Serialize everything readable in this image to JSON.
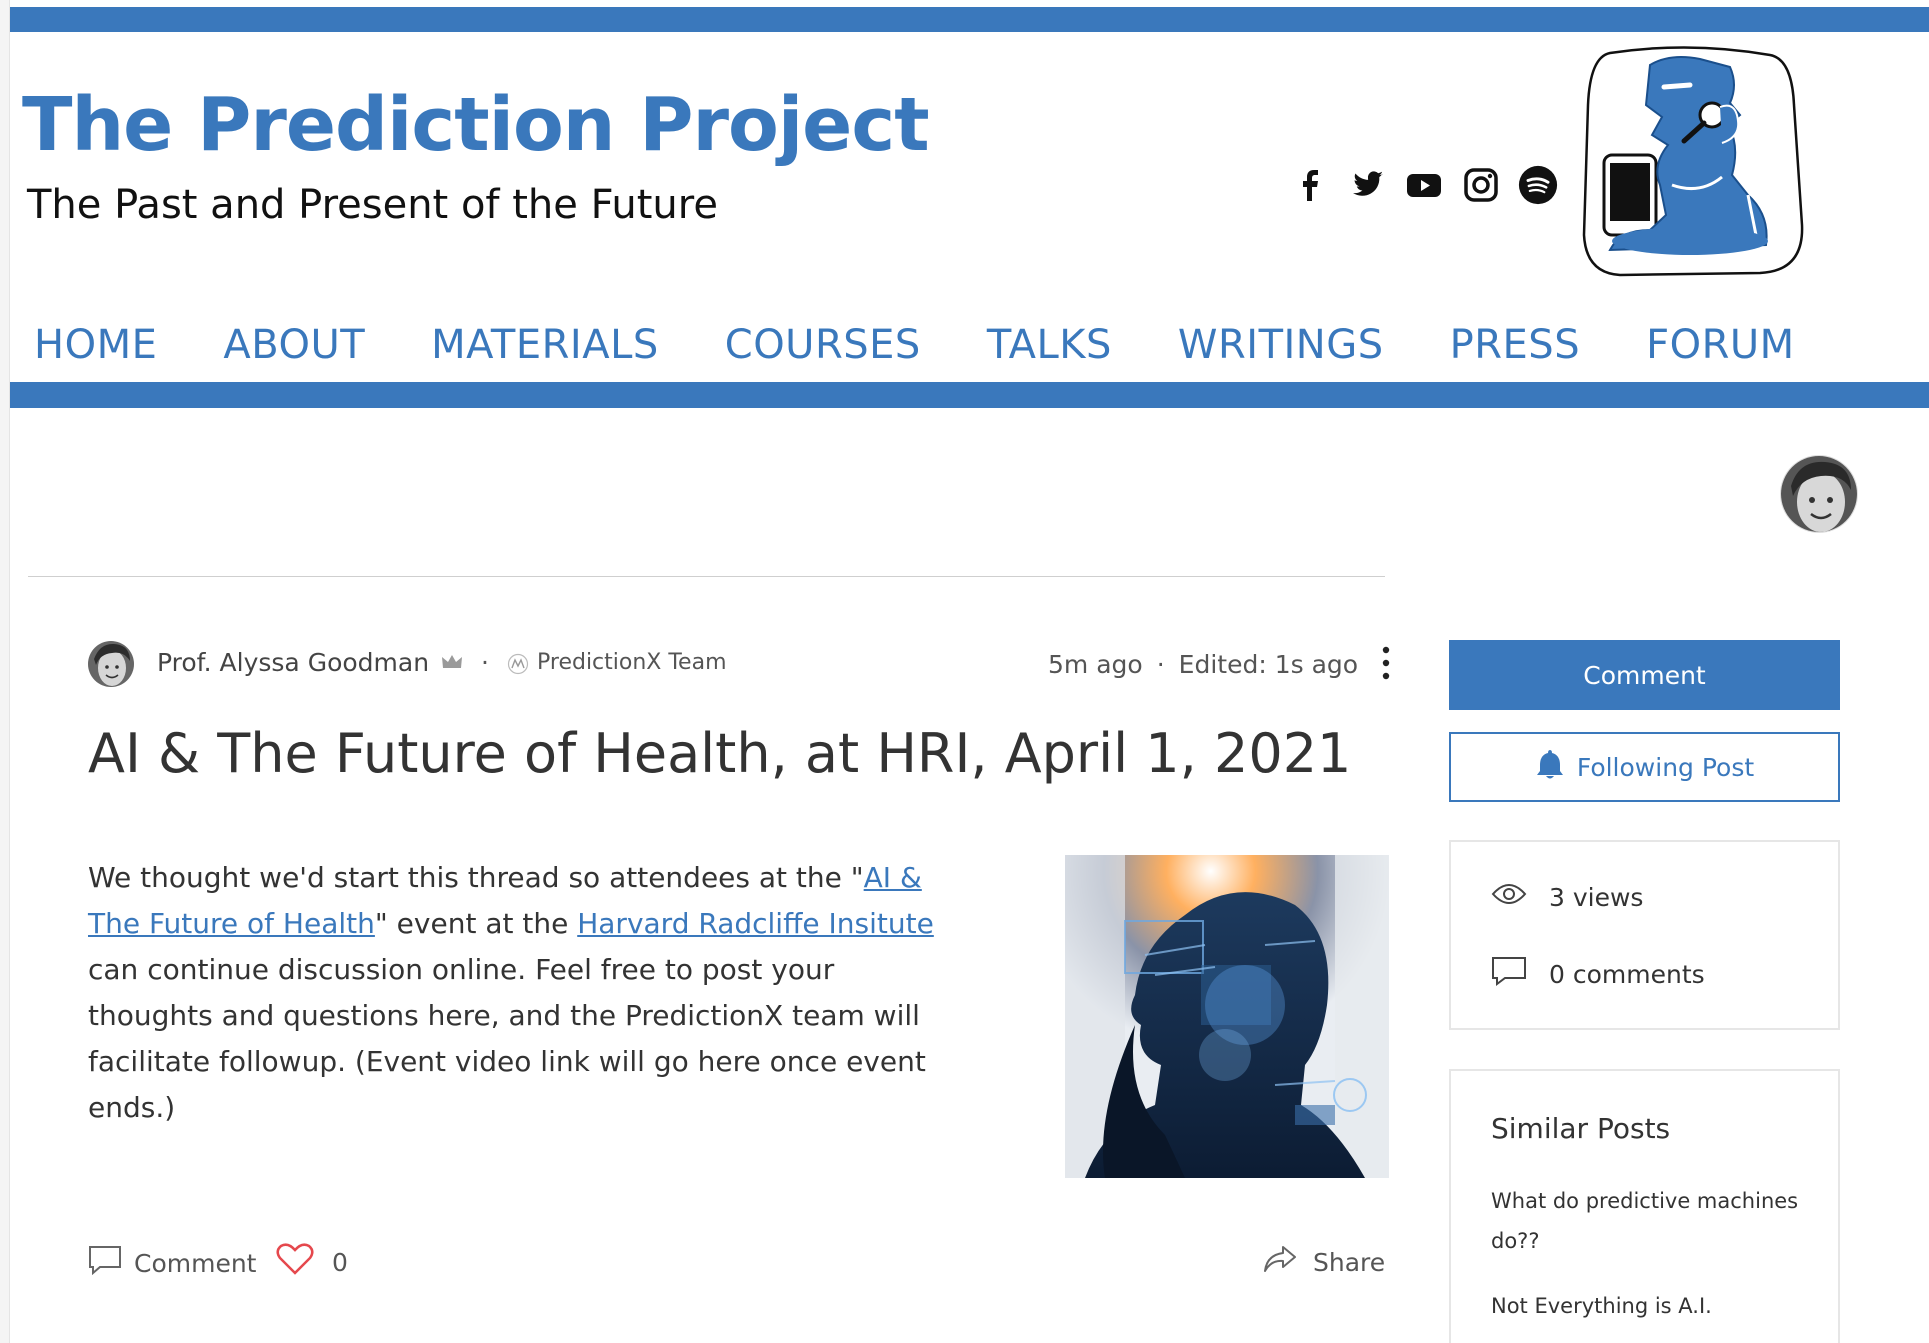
{
  "site": {
    "title": "The Prediction Project",
    "tagline": "The Past and Present of the Future",
    "brand_color": "#3a78bc"
  },
  "social_icons": [
    "facebook-icon",
    "twitter-icon",
    "youtube-icon",
    "instagram-icon",
    "spotify-icon"
  ],
  "nav": {
    "items": [
      "HOME",
      "ABOUT",
      "MATERIALS",
      "COURSES",
      "TALKS",
      "WRITINGS",
      "PRESS",
      "FORUM"
    ]
  },
  "post": {
    "author": "Prof. Alyssa Goodman",
    "team": "PredictionX Team",
    "posted": "5m ago",
    "separator": "·",
    "edited": "Edited: 1s ago",
    "title": "AI & The Future of Health, at HRI, April 1, 2021",
    "body": {
      "p1": "We thought we'd start this thread so attendees at the \"",
      "link1": "AI & The Future of Health",
      "p2": "\" event at the ",
      "link2": "Harvard Radcliffe Insitute ",
      "p3": "can continue discussion online.  Feel free to post your thoughts and questions here, and the PredictionX team will facilitate followup. (Event video link will go here once event ends.)"
    },
    "footer": {
      "comment_label": "Comment",
      "like_count": "0",
      "share_label": "Share"
    }
  },
  "sidebar": {
    "comment_button": "Comment",
    "follow_button": "Following Post",
    "views": "3 views",
    "comments": "0 comments",
    "similar_title": "Similar Posts",
    "similar_posts": [
      "What do predictive machines do??",
      "Not Everything is A.I."
    ]
  }
}
